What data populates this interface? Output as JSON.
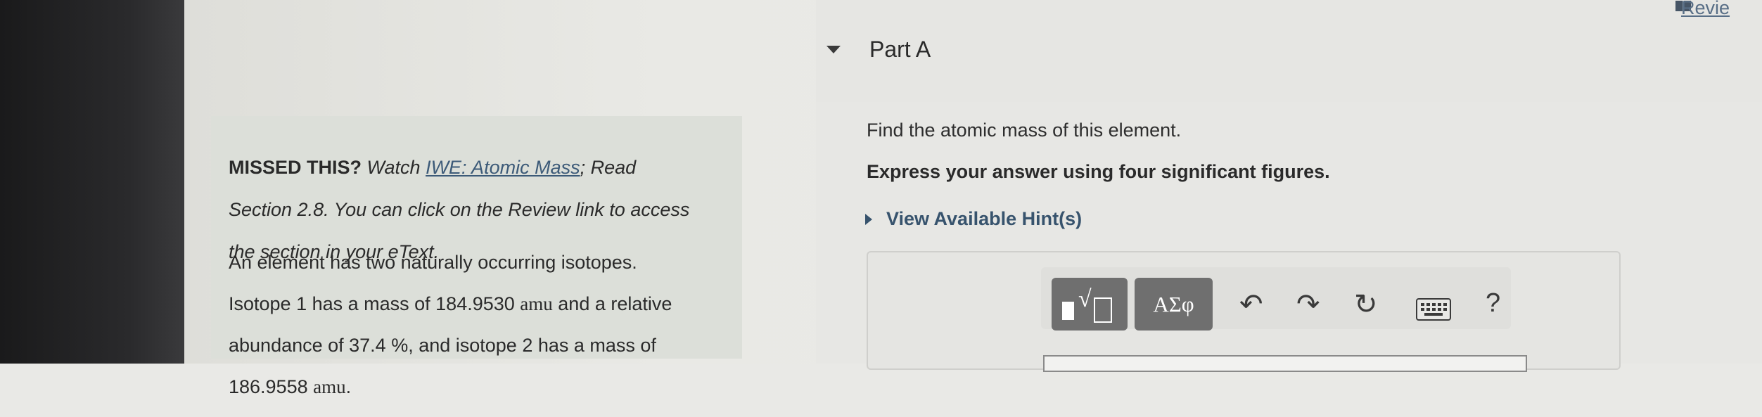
{
  "left_panel": {
    "missed_label": "MISSED THIS?",
    "watch_text": " Watch ",
    "watch_link": "IWE: Atomic Mass",
    "read_text": "; Read",
    "missed_line2": "Section 2.8. You can click on the Review link to access",
    "missed_line3": "the section in your eText.",
    "problem_line1": "An element has two naturally occurring isotopes.",
    "problem_line2_a": "Isotope 1 has a mass of 184.9530 ",
    "unit1": "amu",
    "problem_line2_b": " and a relative",
    "problem_line3": "abundance of 37.4 %, and isotope 2 has a mass of",
    "problem_line4_a": "186.9558 ",
    "unit2": "amu",
    "problem_line4_b": "."
  },
  "header": {
    "part_title": "Part A",
    "review_link": "Revie"
  },
  "question": {
    "prompt": "Find the atomic mass of this element.",
    "instruction": "Express your answer using four significant figures.",
    "hint_toggle": "View Available Hint(s)"
  },
  "toolbar": {
    "greek_label": "ΑΣφ",
    "help_label": "?",
    "icons": [
      "templates-icon",
      "undo-icon",
      "redo-icon",
      "reset-icon",
      "keyboard-icon",
      "help-icon"
    ]
  }
}
